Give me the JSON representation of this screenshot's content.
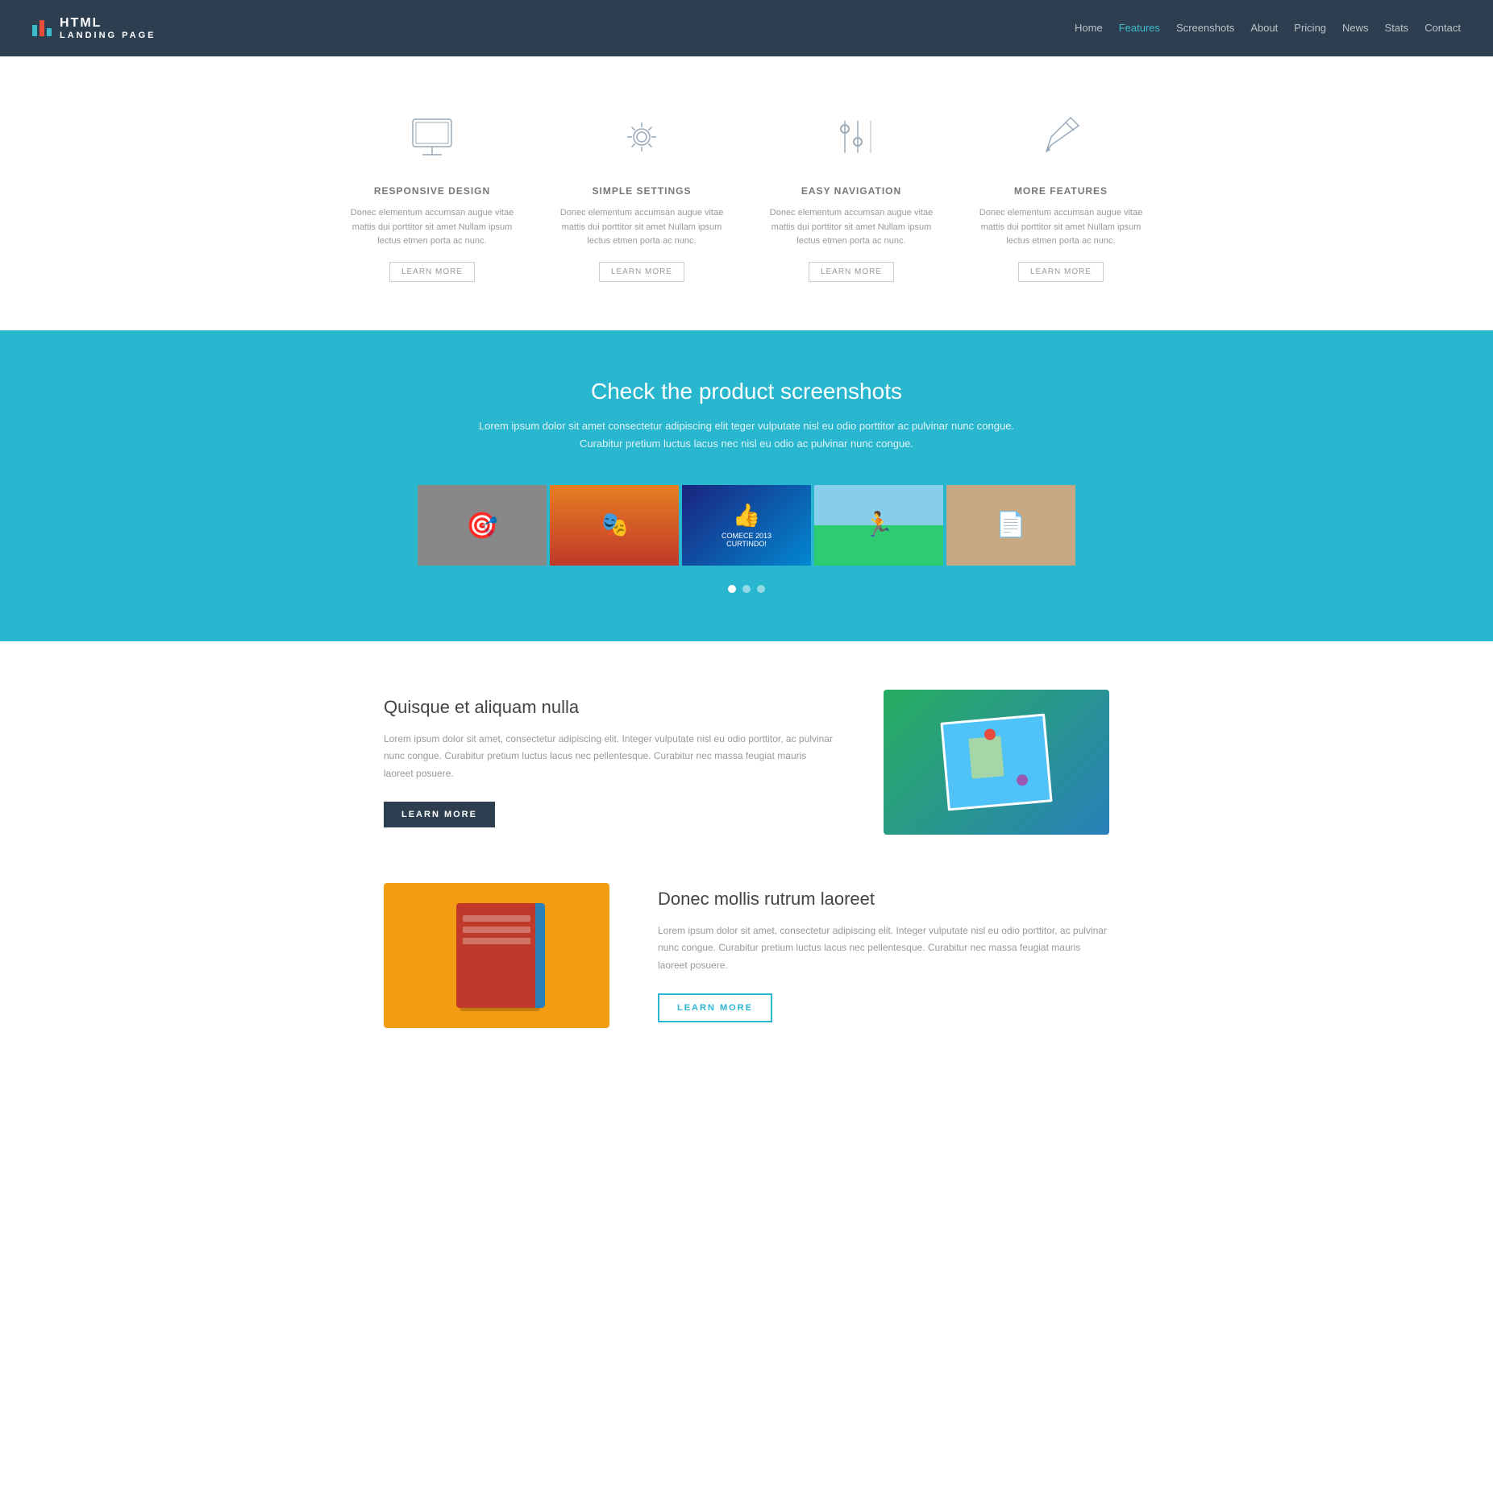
{
  "navbar": {
    "brand": "HTML",
    "brand_sub": "LANDING PAGE",
    "nav_items": [
      {
        "label": "Home",
        "active": false
      },
      {
        "label": "Features",
        "active": true
      },
      {
        "label": "Screenshots",
        "active": false
      },
      {
        "label": "About",
        "active": false
      },
      {
        "label": "Pricing",
        "active": false
      },
      {
        "label": "News",
        "active": false
      },
      {
        "label": "Stats",
        "active": false
      },
      {
        "label": "Contact",
        "active": false
      }
    ]
  },
  "features": {
    "items": [
      {
        "icon": "monitor",
        "title": "RESPONSIVE DESIGN",
        "desc": "Donec elementum accumsan augue vitae mattis dui porttitor sit amet Nullam ipsum lectus etmen porta ac nunc.",
        "btn": "LEARN MORE"
      },
      {
        "icon": "gear",
        "title": "SIMPLE SETTINGS",
        "desc": "Donec elementum accumsan augue vitae mattis dui porttitor sit amet Nullam ipsum lectus etmen porta ac nunc.",
        "btn": "LEARN MORE"
      },
      {
        "icon": "sliders",
        "title": "EASY NAVIGATION",
        "desc": "Donec elementum accumsan augue vitae mattis dui porttitor sit amet Nullam ipsum lectus etmen porta ac nunc.",
        "btn": "LEARN MORE"
      },
      {
        "icon": "pencil",
        "title": "MORE FEATURES",
        "desc": "Donec elementum accumsan augue vitae mattis dui porttitor sit amet Nullam ipsum lectus etmen porta ac nunc.",
        "btn": "LEARN MORE"
      }
    ]
  },
  "screenshots": {
    "title": "Check the product screenshots",
    "desc": "Lorem ipsum dolor sit amet consectetur adipiscing elit teger vulputate nisl eu odio porttitor ac pulvinar nunc congue.\nCurabitur pretium luctus lacus nec nisl eu odio ac pulvinar nunc congue.",
    "thumbs": [
      {
        "label": "thumb1"
      },
      {
        "label": "thumb2"
      },
      {
        "label": "thumb3"
      },
      {
        "label": "thumb4"
      },
      {
        "label": "thumb5"
      }
    ]
  },
  "content1": {
    "title": "Quisque et aliquam nulla",
    "desc": "Lorem ipsum dolor sit amet, consectetur adipiscing elit. Integer vulputate nisl eu odio porttitor, ac pulvinar nunc congue. Curabitur pretium luctus lacus nec pellentesque. Curabitur nec massa feugiat mauris laoreet posuere.",
    "btn": "LEARN MORE"
  },
  "content2": {
    "title": "Donec mollis rutrum laoreet",
    "desc": "Lorem ipsum dolor sit amet, consectetur adipiscing elit. Integer vulputate nisl eu odio porttitor, ac pulvinar nunc congue. Curabitur pretium luctus lacus nec pellentesque. Curabitur nec massa feugiat mauris laoreet posuere.",
    "btn": "LEARN MORE"
  }
}
